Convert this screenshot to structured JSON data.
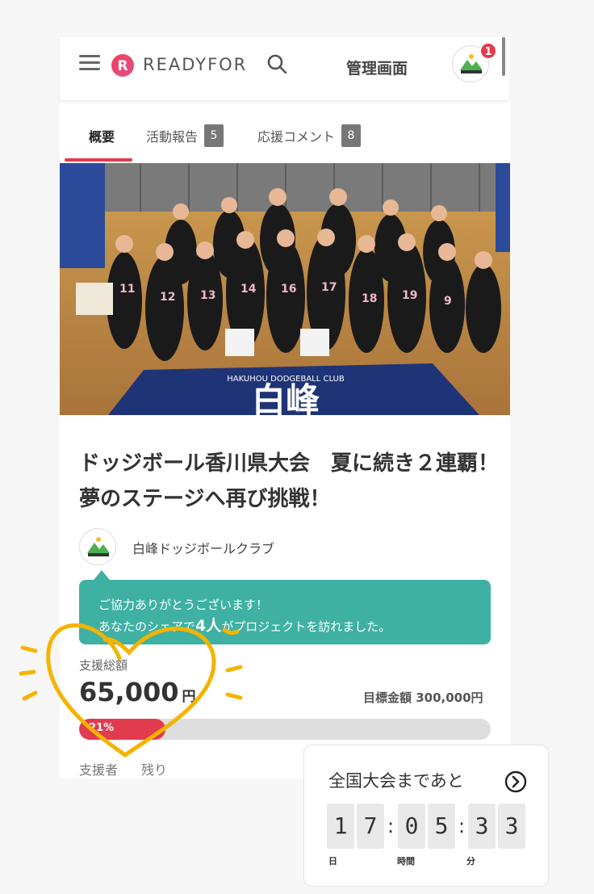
{
  "header": {
    "logo_text": "READYFOR",
    "admin_label": "管理画面",
    "notification_count": "1"
  },
  "tabs": [
    {
      "label": "概要",
      "active": true
    },
    {
      "label": "活動報告",
      "count": "5"
    },
    {
      "label": "応援コメント",
      "count": "8"
    }
  ],
  "project": {
    "title": "ドッジボール香川県大会　夏に続き２連覇！夢のステージへ再び挑戦！",
    "organizer": "白峰ドッジボールクラブ",
    "banner_text": "HAKUHOU DODGEBALL CLUB",
    "banner_kanji": "白峰"
  },
  "thanks": {
    "line1": "ご協力ありがとうございます！",
    "line2_prefix": "あなたのシェアで",
    "count": "4人",
    "line2_suffix": "がプロジェクトを訪れました。"
  },
  "funding": {
    "label": "支援総額",
    "amount": "65,000",
    "unit": "円",
    "goal_label": "目標金額 300,000円",
    "percent": 21,
    "percent_label": "21%",
    "supporters_label": "支援者",
    "remaining_label": "残り"
  },
  "countdown": {
    "title": "全国大会まであと",
    "digits": [
      "1",
      "7",
      "0",
      "5",
      "3",
      "3"
    ],
    "separator": ":",
    "units": [
      "日",
      "時間",
      "分"
    ]
  },
  "colors": {
    "accent": "#e23a4e",
    "teal": "#3fb1a3",
    "annotation": "#f4b400"
  }
}
